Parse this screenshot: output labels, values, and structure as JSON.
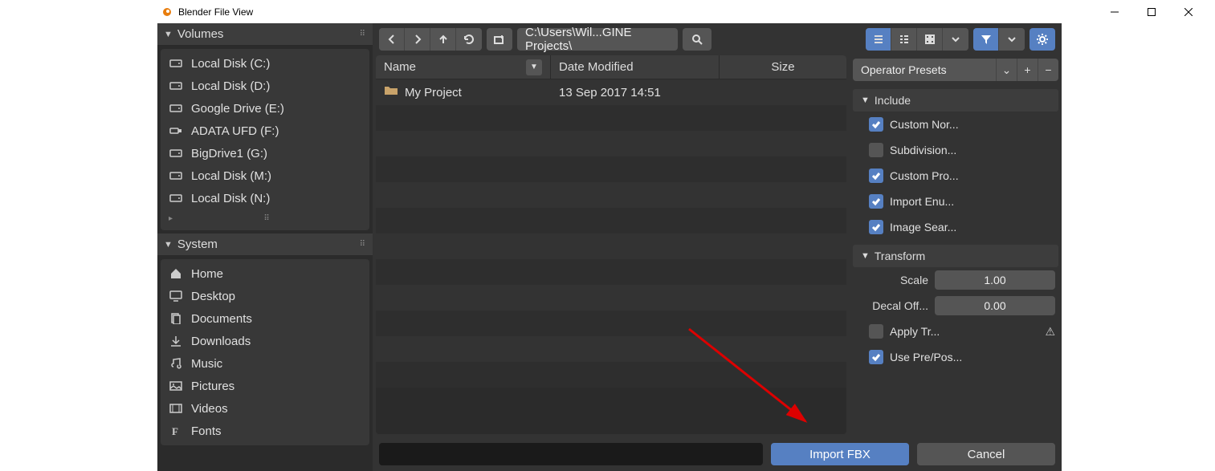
{
  "window": {
    "title": "Blender File View"
  },
  "sidebar": {
    "volumes_label": "Volumes",
    "volumes": [
      {
        "label": "Local Disk (C:)",
        "icon": "disk"
      },
      {
        "label": "Local Disk (D:)",
        "icon": "disk"
      },
      {
        "label": "Google Drive (E:)",
        "icon": "disk"
      },
      {
        "label": "ADATA UFD (F:)",
        "icon": "usb"
      },
      {
        "label": "BigDrive1 (G:)",
        "icon": "disk"
      },
      {
        "label": "Local Disk (M:)",
        "icon": "disk"
      },
      {
        "label": "Local Disk (N:)",
        "icon": "disk"
      }
    ],
    "system_label": "System",
    "system": [
      {
        "label": "Home",
        "icon": "home"
      },
      {
        "label": "Desktop",
        "icon": "desktop"
      },
      {
        "label": "Documents",
        "icon": "documents"
      },
      {
        "label": "Downloads",
        "icon": "download"
      },
      {
        "label": "Music",
        "icon": "music"
      },
      {
        "label": "Pictures",
        "icon": "pictures"
      },
      {
        "label": "Videos",
        "icon": "videos"
      },
      {
        "label": "Fonts",
        "icon": "fonts"
      }
    ]
  },
  "toolbar": {
    "path": "C:\\Users\\Wil...GINE Projects\\"
  },
  "filelist": {
    "col_name": "Name",
    "col_date": "Date Modified",
    "col_size": "Size",
    "rows": [
      {
        "name": "My Project",
        "date": "13 Sep 2017 14:51",
        "size": ""
      }
    ]
  },
  "rightpanel": {
    "preset_label": "Operator Presets",
    "include_label": "Include",
    "include_opts": [
      {
        "label": "Custom Nor...",
        "checked": true
      },
      {
        "label": "Subdivision...",
        "checked": false
      },
      {
        "label": "Custom Pro...",
        "checked": true
      },
      {
        "label": "Import Enu...",
        "checked": true
      },
      {
        "label": "Image Sear...",
        "checked": true
      }
    ],
    "transform_label": "Transform",
    "scale_label": "Scale",
    "scale_value": "1.00",
    "decal_label": "Decal Off...",
    "decal_value": "0.00",
    "transform_opts": [
      {
        "label": "Apply Tr...",
        "checked": false,
        "warn": true
      },
      {
        "label": "Use Pre/Pos...",
        "checked": true
      }
    ]
  },
  "actions": {
    "import": "Import FBX",
    "cancel": "Cancel"
  }
}
